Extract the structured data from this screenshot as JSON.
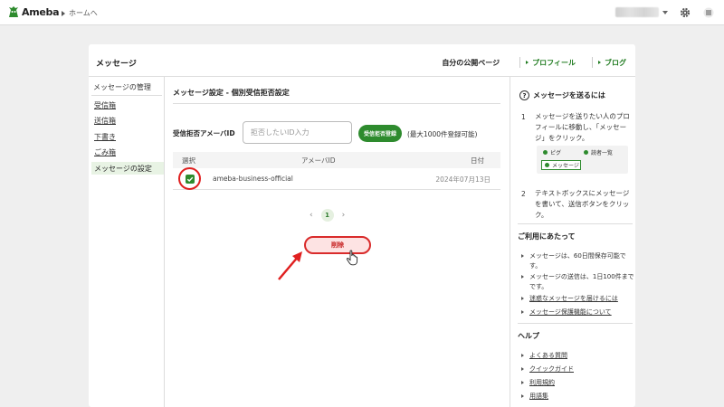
{
  "header": {
    "logo_text": "Ameba",
    "home_link": "ホームへ",
    "icons": [
      "gear-icon",
      "menu-icon"
    ]
  },
  "card": {
    "title": "メッセージ",
    "public_page_label": "自分の公開ページ",
    "profile_link": "プロフィール",
    "blog_link": "ブログ"
  },
  "sidebar": {
    "heading": "メッセージの管理",
    "items": [
      {
        "label": "受信箱"
      },
      {
        "label": "送信箱"
      },
      {
        "label": "下書き"
      },
      {
        "label": "ごみ箱"
      },
      {
        "label": "メッセージの設定",
        "active": true
      }
    ]
  },
  "main": {
    "title": "メッセージ設定 - 個別受信拒否設定",
    "block_label": "受信拒否アメーバID",
    "input_placeholder": "拒否したいID入力",
    "block_button": "受信拒否登録",
    "max_note": "(最大1000件登録可能)",
    "table": {
      "headers": {
        "select": "選択",
        "id": "アメーバID",
        "date": "日付"
      },
      "rows": [
        {
          "id": "ameba-business-official",
          "date": "2024年07月13日",
          "checked": true
        }
      ]
    },
    "pagination": {
      "prev": "‹",
      "current": "1",
      "next": "›"
    },
    "delete_button": "削除"
  },
  "right": {
    "help_title": "メッセージを送るには",
    "steps": [
      {
        "num": "1",
        "text": "メッセージを送りたい人のプロフィールに移動し、「メッセージ」をクリック。"
      },
      {
        "num": "2",
        "text": "テキストボックスにメッセージを書いて、送信ボタンをクリック。"
      }
    ],
    "illustration": {
      "pig_label": "ピグ",
      "reader_label": "読者一覧",
      "message_button": "メッセージ"
    },
    "usage_title": "ご利用にあたって",
    "usage_items": [
      {
        "text": "メッセージは、60日間保存可能です。",
        "link": false
      },
      {
        "text": "メッセージの送信は、1日100件までです。",
        "link": false
      },
      {
        "text": "迷惑なメッセージを届けるには",
        "link": true
      },
      {
        "text": "メッセージ保護機能について",
        "link": true
      }
    ],
    "help_section_title": "ヘルプ",
    "help_links": [
      {
        "text": "よくある質問"
      },
      {
        "text": "クイックガイド"
      },
      {
        "text": "利用規約"
      },
      {
        "text": "用語集"
      }
    ]
  },
  "colors": {
    "accent_green": "#2e8b2e",
    "alert_red": "#d92b2b",
    "background": "#efefef"
  }
}
